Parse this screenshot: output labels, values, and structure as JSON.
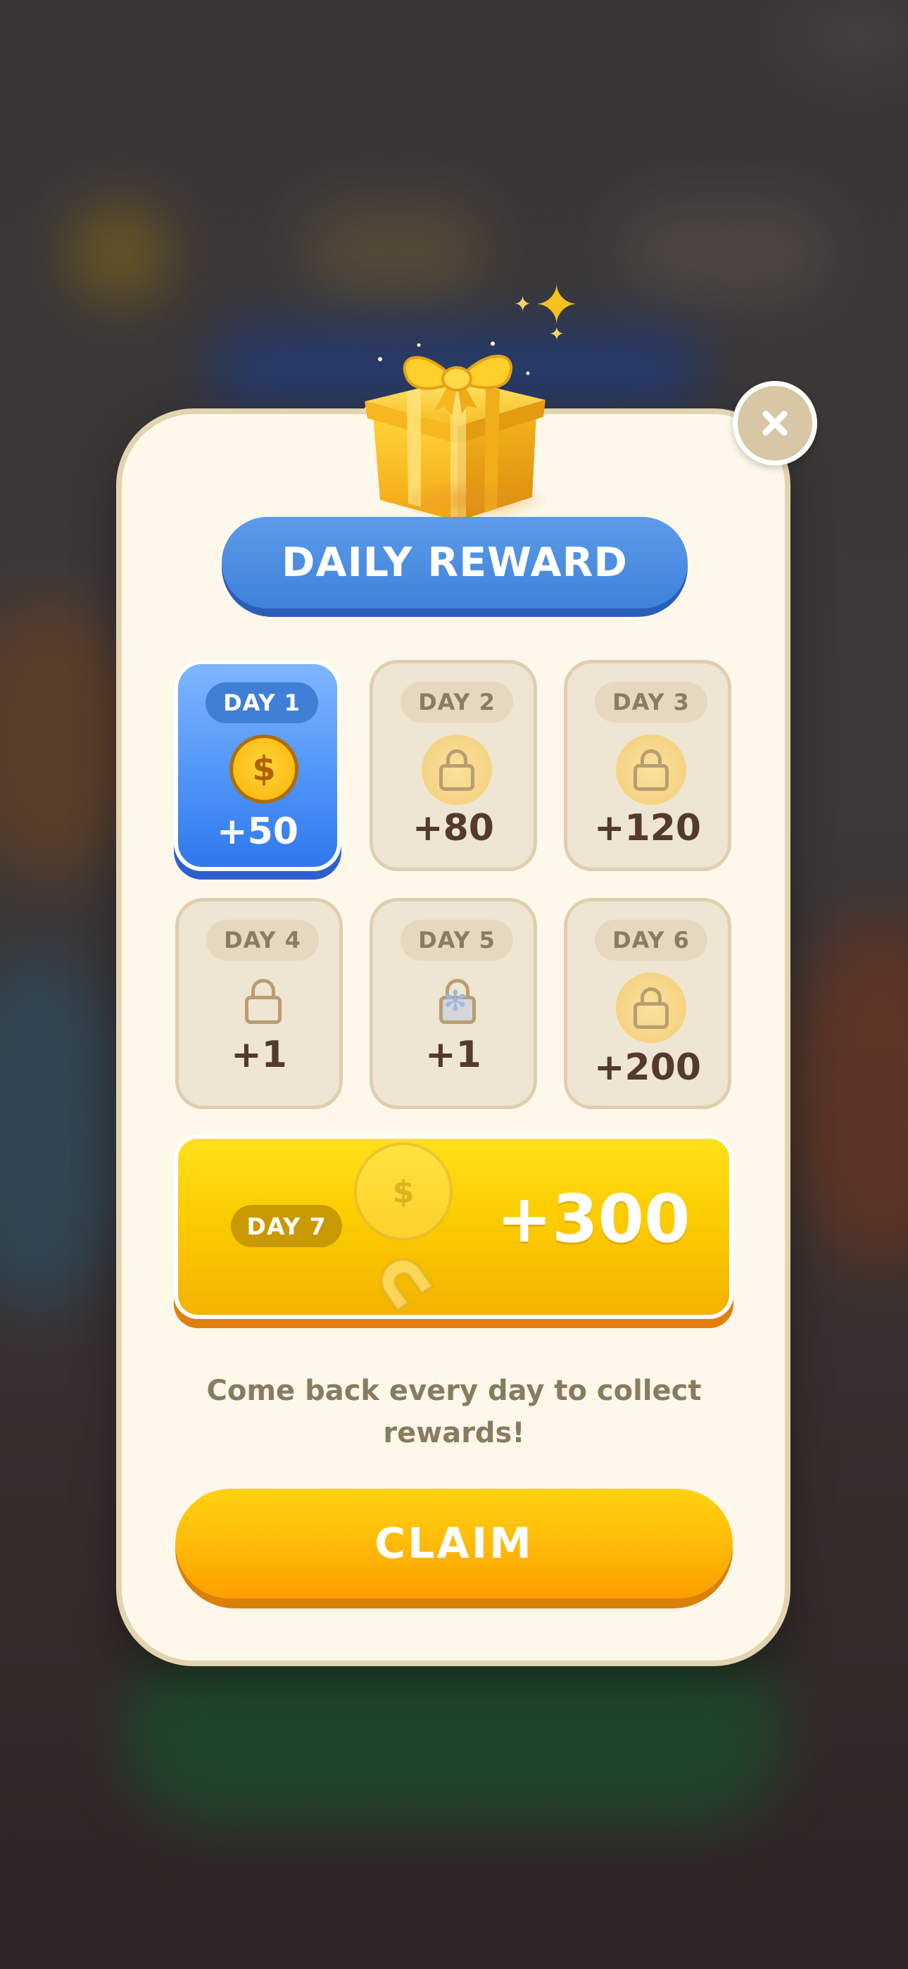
{
  "title": "DAILY REWARD",
  "days": [
    {
      "label": "DAY 1",
      "amount": "+50",
      "state": "active",
      "icon": "coin-icon",
      "coin_symbol": "$"
    },
    {
      "label": "DAY 2",
      "amount": "+80",
      "state": "locked",
      "icon": "lock-icon"
    },
    {
      "label": "DAY 3",
      "amount": "+120",
      "state": "locked",
      "icon": "lock-icon"
    },
    {
      "label": "DAY 4",
      "amount": "+1",
      "state": "locked",
      "icon": "lock-icon"
    },
    {
      "label": "DAY 5",
      "amount": "+1",
      "state": "locked",
      "icon": "lock-icon"
    },
    {
      "label": "DAY 6",
      "amount": "+200",
      "state": "locked",
      "icon": "lock-icon"
    }
  ],
  "day7": {
    "label": "DAY 7",
    "amount": "+300",
    "coin_symbol": "$",
    "icons": [
      "coin-icon",
      "magnet-icon"
    ]
  },
  "footer_text": "Come back every day to collect rewards!",
  "claim_label": "CLAIM",
  "colors": {
    "panel": "#fdf8ea",
    "panel_border": "#e3d4b1",
    "title_banner": "#4a8ce0",
    "active_card": "#4f95f7",
    "locked_card": "#efe5d3",
    "gold": "#fccc00",
    "claim": "#ffb808",
    "amount_text": "#533a2c"
  }
}
